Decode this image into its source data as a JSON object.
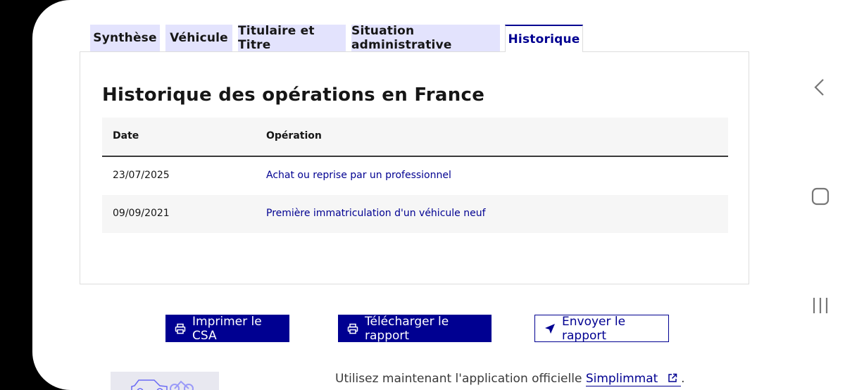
{
  "tabs": [
    {
      "label": "Synthèse"
    },
    {
      "label": "Véhicule"
    },
    {
      "label": "Titulaire et Titre"
    },
    {
      "label": "Situation administrative"
    },
    {
      "label": "Historique"
    }
  ],
  "active_tab": "Historique",
  "panel": {
    "title": "Historique des opérations en France",
    "columns": [
      "Date",
      "Opération"
    ],
    "rows": [
      {
        "date": "23/07/2025",
        "operation": "Achat ou reprise par un professionnel"
      },
      {
        "date": "09/09/2021",
        "operation": "Première immatriculation d'un véhicule neuf"
      }
    ]
  },
  "actions": {
    "print_label": "Imprimer le CSA",
    "download_label": "Télécharger le rapport",
    "send_label": "Envoyer le rapport"
  },
  "promo": {
    "text": "Utilisez maintenant l'application officielle",
    "link": "Simplimmat",
    "suffix": "."
  },
  "colors": {
    "primary": "#000091",
    "tab_bg": "#e3e3fd",
    "row_alt": "#f6f6f6"
  },
  "system_nav": {
    "back_icon": "chevron-left-icon",
    "home_icon": "home-square-icon",
    "recents_icon": "recents-bars-icon"
  }
}
